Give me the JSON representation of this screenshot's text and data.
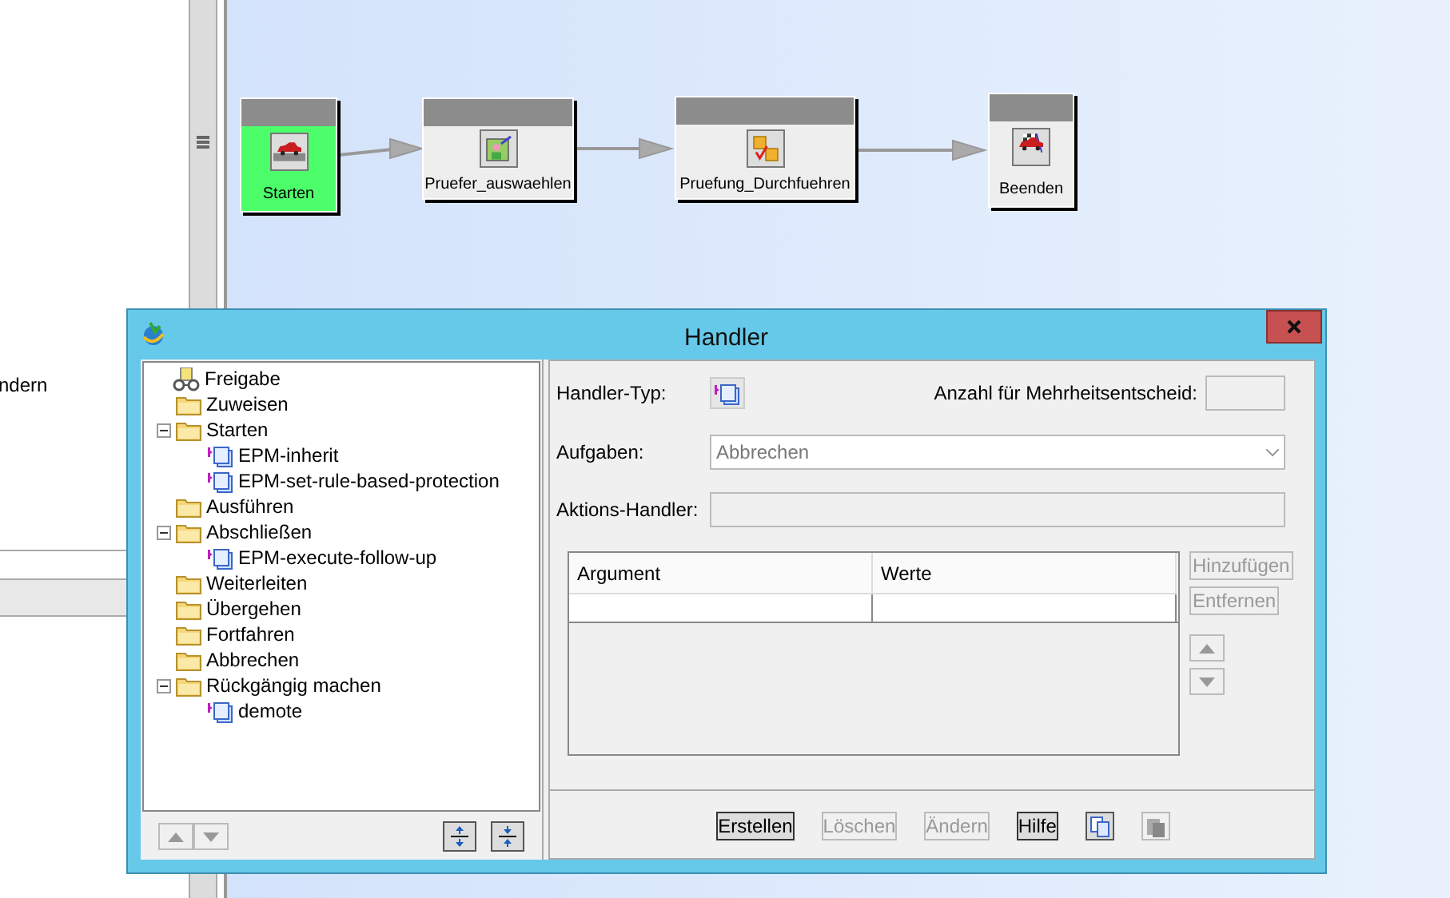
{
  "left_panel": {
    "text": "ndern"
  },
  "diagram": {
    "nodes": [
      {
        "label": "Starten",
        "kind": "start",
        "active": true
      },
      {
        "label": "Pruefer_auswaehlen",
        "kind": "select",
        "active": false
      },
      {
        "label": "Pruefung_Durchfuehren",
        "kind": "review",
        "active": false
      },
      {
        "label": "Beenden",
        "kind": "finish",
        "active": false
      }
    ]
  },
  "dialog": {
    "title": "Handler",
    "tree": {
      "label": "Freigabe",
      "kind": "root",
      "children": [
        {
          "label": "Zuweisen",
          "kind": "folder"
        },
        {
          "label": "Starten",
          "kind": "folder",
          "expanded": true,
          "children": [
            {
              "label": "EPM-inherit",
              "kind": "handler"
            },
            {
              "label": "EPM-set-rule-based-protection",
              "kind": "handler"
            }
          ]
        },
        {
          "label": "Ausführen",
          "kind": "folder"
        },
        {
          "label": "Abschließen",
          "kind": "folder",
          "expanded": true,
          "children": [
            {
              "label": "EPM-execute-follow-up",
              "kind": "handler"
            }
          ]
        },
        {
          "label": "Weiterleiten",
          "kind": "folder"
        },
        {
          "label": "Übergehen",
          "kind": "folder"
        },
        {
          "label": "Fortfahren",
          "kind": "folder"
        },
        {
          "label": "Abbrechen",
          "kind": "folder"
        },
        {
          "label": "Rückgängig machen",
          "kind": "folder",
          "expanded": true,
          "children": [
            {
              "label": "demote",
              "kind": "handler"
            }
          ]
        }
      ]
    },
    "handler_type_label": "Handler-Typ:",
    "majority_label": "Anzahl für Mehrheitsentscheid:",
    "tasks_label": "Aufgaben:",
    "tasks_value": "Abbrechen",
    "action_handler_label": "Aktions-Handler:",
    "table": {
      "columns": [
        "Argument",
        "Werte"
      ]
    },
    "side_buttons": [
      {
        "label": "Hinzufügen",
        "disabled": true
      },
      {
        "label": "Entfernen",
        "disabled": true
      }
    ],
    "buttons": [
      {
        "label": "Erstellen",
        "disabled": false
      },
      {
        "label": "Löschen",
        "disabled": true
      },
      {
        "label": "Ändern",
        "disabled": true
      },
      {
        "label": "Hilfe",
        "disabled": false
      }
    ]
  }
}
